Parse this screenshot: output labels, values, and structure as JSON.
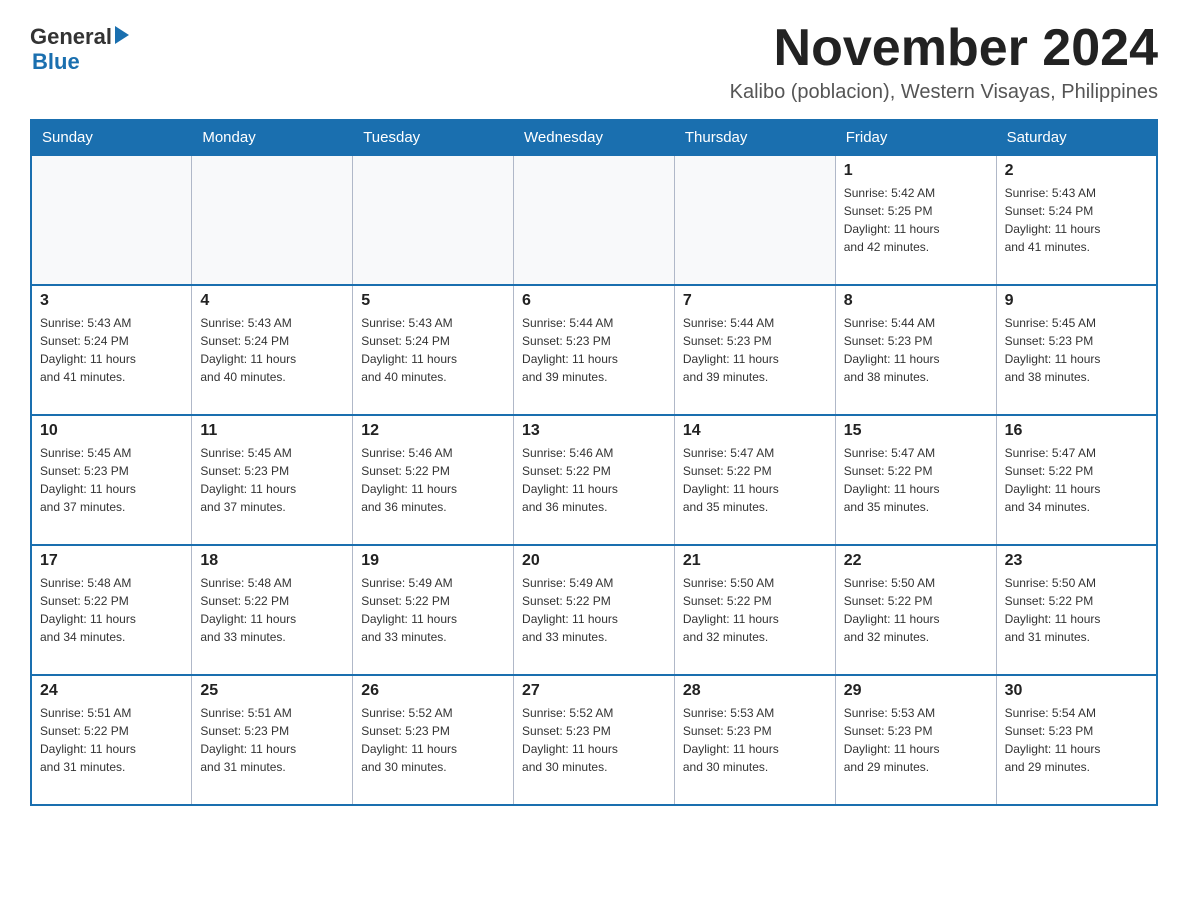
{
  "header": {
    "logo_line1": "General",
    "logo_line2": "Blue",
    "month_title": "November 2024",
    "subtitle": "Kalibo (poblacion), Western Visayas, Philippines"
  },
  "days_of_week": [
    "Sunday",
    "Monday",
    "Tuesday",
    "Wednesday",
    "Thursday",
    "Friday",
    "Saturday"
  ],
  "weeks": [
    {
      "days": [
        {
          "date": "",
          "info": ""
        },
        {
          "date": "",
          "info": ""
        },
        {
          "date": "",
          "info": ""
        },
        {
          "date": "",
          "info": ""
        },
        {
          "date": "",
          "info": ""
        },
        {
          "date": "1",
          "info": "Sunrise: 5:42 AM\nSunset: 5:25 PM\nDaylight: 11 hours\nand 42 minutes."
        },
        {
          "date": "2",
          "info": "Sunrise: 5:43 AM\nSunset: 5:24 PM\nDaylight: 11 hours\nand 41 minutes."
        }
      ]
    },
    {
      "days": [
        {
          "date": "3",
          "info": "Sunrise: 5:43 AM\nSunset: 5:24 PM\nDaylight: 11 hours\nand 41 minutes."
        },
        {
          "date": "4",
          "info": "Sunrise: 5:43 AM\nSunset: 5:24 PM\nDaylight: 11 hours\nand 40 minutes."
        },
        {
          "date": "5",
          "info": "Sunrise: 5:43 AM\nSunset: 5:24 PM\nDaylight: 11 hours\nand 40 minutes."
        },
        {
          "date": "6",
          "info": "Sunrise: 5:44 AM\nSunset: 5:23 PM\nDaylight: 11 hours\nand 39 minutes."
        },
        {
          "date": "7",
          "info": "Sunrise: 5:44 AM\nSunset: 5:23 PM\nDaylight: 11 hours\nand 39 minutes."
        },
        {
          "date": "8",
          "info": "Sunrise: 5:44 AM\nSunset: 5:23 PM\nDaylight: 11 hours\nand 38 minutes."
        },
        {
          "date": "9",
          "info": "Sunrise: 5:45 AM\nSunset: 5:23 PM\nDaylight: 11 hours\nand 38 minutes."
        }
      ]
    },
    {
      "days": [
        {
          "date": "10",
          "info": "Sunrise: 5:45 AM\nSunset: 5:23 PM\nDaylight: 11 hours\nand 37 minutes."
        },
        {
          "date": "11",
          "info": "Sunrise: 5:45 AM\nSunset: 5:23 PM\nDaylight: 11 hours\nand 37 minutes."
        },
        {
          "date": "12",
          "info": "Sunrise: 5:46 AM\nSunset: 5:22 PM\nDaylight: 11 hours\nand 36 minutes."
        },
        {
          "date": "13",
          "info": "Sunrise: 5:46 AM\nSunset: 5:22 PM\nDaylight: 11 hours\nand 36 minutes."
        },
        {
          "date": "14",
          "info": "Sunrise: 5:47 AM\nSunset: 5:22 PM\nDaylight: 11 hours\nand 35 minutes."
        },
        {
          "date": "15",
          "info": "Sunrise: 5:47 AM\nSunset: 5:22 PM\nDaylight: 11 hours\nand 35 minutes."
        },
        {
          "date": "16",
          "info": "Sunrise: 5:47 AM\nSunset: 5:22 PM\nDaylight: 11 hours\nand 34 minutes."
        }
      ]
    },
    {
      "days": [
        {
          "date": "17",
          "info": "Sunrise: 5:48 AM\nSunset: 5:22 PM\nDaylight: 11 hours\nand 34 minutes."
        },
        {
          "date": "18",
          "info": "Sunrise: 5:48 AM\nSunset: 5:22 PM\nDaylight: 11 hours\nand 33 minutes."
        },
        {
          "date": "19",
          "info": "Sunrise: 5:49 AM\nSunset: 5:22 PM\nDaylight: 11 hours\nand 33 minutes."
        },
        {
          "date": "20",
          "info": "Sunrise: 5:49 AM\nSunset: 5:22 PM\nDaylight: 11 hours\nand 33 minutes."
        },
        {
          "date": "21",
          "info": "Sunrise: 5:50 AM\nSunset: 5:22 PM\nDaylight: 11 hours\nand 32 minutes."
        },
        {
          "date": "22",
          "info": "Sunrise: 5:50 AM\nSunset: 5:22 PM\nDaylight: 11 hours\nand 32 minutes."
        },
        {
          "date": "23",
          "info": "Sunrise: 5:50 AM\nSunset: 5:22 PM\nDaylight: 11 hours\nand 31 minutes."
        }
      ]
    },
    {
      "days": [
        {
          "date": "24",
          "info": "Sunrise: 5:51 AM\nSunset: 5:22 PM\nDaylight: 11 hours\nand 31 minutes."
        },
        {
          "date": "25",
          "info": "Sunrise: 5:51 AM\nSunset: 5:23 PM\nDaylight: 11 hours\nand 31 minutes."
        },
        {
          "date": "26",
          "info": "Sunrise: 5:52 AM\nSunset: 5:23 PM\nDaylight: 11 hours\nand 30 minutes."
        },
        {
          "date": "27",
          "info": "Sunrise: 5:52 AM\nSunset: 5:23 PM\nDaylight: 11 hours\nand 30 minutes."
        },
        {
          "date": "28",
          "info": "Sunrise: 5:53 AM\nSunset: 5:23 PM\nDaylight: 11 hours\nand 30 minutes."
        },
        {
          "date": "29",
          "info": "Sunrise: 5:53 AM\nSunset: 5:23 PM\nDaylight: 11 hours\nand 29 minutes."
        },
        {
          "date": "30",
          "info": "Sunrise: 5:54 AM\nSunset: 5:23 PM\nDaylight: 11 hours\nand 29 minutes."
        }
      ]
    }
  ]
}
